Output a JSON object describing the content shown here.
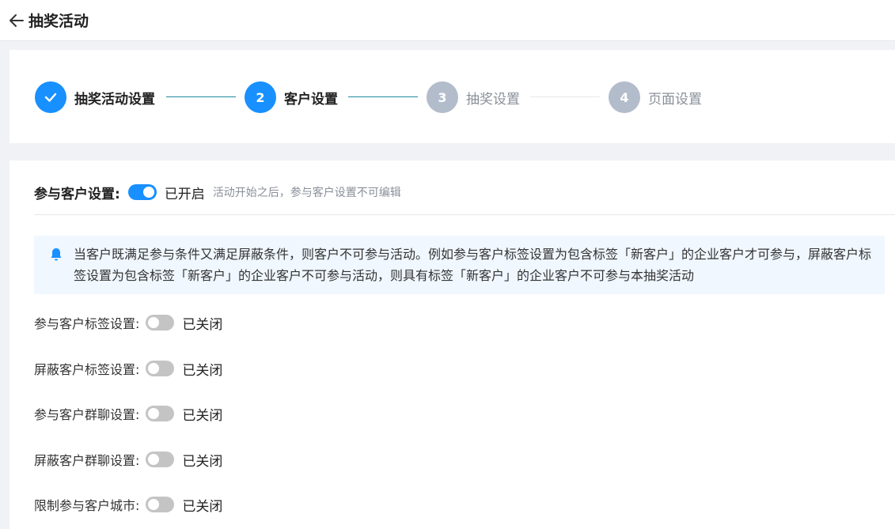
{
  "header": {
    "title": "抽奖活动"
  },
  "steps": [
    {
      "number": "",
      "label": "抽奖活动设置",
      "state": "done"
    },
    {
      "number": "2",
      "label": "客户设置",
      "state": "active"
    },
    {
      "number": "3",
      "label": "抽奖设置",
      "state": "pending"
    },
    {
      "number": "4",
      "label": "页面设置",
      "state": "pending"
    }
  ],
  "participant": {
    "title": "参与客户设置:",
    "status": "已开启",
    "enabled": true,
    "hint": "活动开始之后，参与客户设置不可编辑"
  },
  "notice": {
    "text": "当客户既满足参与条件又满足屏蔽条件，则客户不可参与活动。例如参与客户标签设置为包含标签「新客户」的企业客户才可参与，屏蔽客户标签设置为包含标签「新客户」的企业客户不可参与活动，则具有标签「新客户」的企业客户不可参与本抽奖活动"
  },
  "settings": [
    {
      "label": "参与客户标签设置:",
      "status": "已关闭",
      "enabled": false
    },
    {
      "label": "屏蔽客户标签设置:",
      "status": "已关闭",
      "enabled": false
    },
    {
      "label": "参与客户群聊设置:",
      "status": "已关闭",
      "enabled": false
    },
    {
      "label": "屏蔽客户群聊设置:",
      "status": "已关闭",
      "enabled": false
    },
    {
      "label": "限制参与客户城市:",
      "status": "已关闭",
      "enabled": false
    }
  ],
  "colors": {
    "primary": "#1890ff",
    "pending": "#b3bccb",
    "notice_bg": "#f0f7ff"
  }
}
